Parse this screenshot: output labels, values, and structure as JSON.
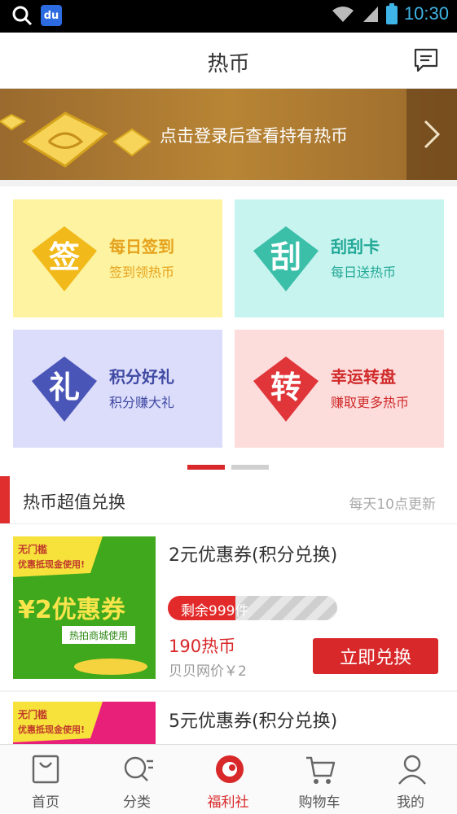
{
  "status_bar": {
    "time": "10:30",
    "baidu_icon_text": "du"
  },
  "header": {
    "title": "热币"
  },
  "banner": {
    "text": "点击登录后查看持有热币"
  },
  "grid": [
    {
      "badge": "签",
      "title": "每日签到",
      "subtitle": "签到领热币",
      "bg": "#fdf3a0",
      "accent": "#e6a21c",
      "badge_color": "#f2b91a"
    },
    {
      "badge": "刮",
      "title": "刮刮卡",
      "subtitle": "每日送热币",
      "bg": "#c8f4ef",
      "accent": "#22a896",
      "badge_color": "#3cbfa9"
    },
    {
      "badge": "礼",
      "title": "积分好礼",
      "subtitle": "积分赚大礼",
      "bg": "#dcdcfb",
      "accent": "#3f4aa3",
      "badge_color": "#4a55b8"
    },
    {
      "badge": "转",
      "title": "幸运转盘",
      "subtitle": "赚取更多热币",
      "bg": "#fddcdc",
      "accent": "#d02a2a",
      "badge_color": "#e0363a"
    }
  ],
  "pager": {
    "active_index": 0,
    "count": 2
  },
  "section": {
    "title": "热币超值兑换",
    "note": "每天10点更新"
  },
  "items": [
    {
      "name": "2元优惠券(积分兑换)",
      "thumb": {
        "tag": "无门槛",
        "tag2": "优惠抵现金使用!",
        "big": "¥2优惠券",
        "sub": "热拍商城使用"
      },
      "remaining": "剩余999件",
      "remaining_fraction": 0.4,
      "price": "190热币",
      "ref_price": "贝贝网价￥2",
      "button": "立即兑换"
    },
    {
      "name": "5元优惠券(积分兑换)",
      "thumb": {
        "tag": "无门槛",
        "tag2": "优惠抵现金使用!"
      }
    }
  ],
  "tabs": [
    {
      "label": "首页",
      "icon": "bag-icon",
      "active": false
    },
    {
      "label": "分类",
      "icon": "category-search-icon",
      "active": false
    },
    {
      "label": "福利社",
      "icon": "welfare-icon",
      "active": true
    },
    {
      "label": "购物车",
      "icon": "cart-icon",
      "active": false
    },
    {
      "label": "我的",
      "icon": "user-icon",
      "active": false
    }
  ],
  "colors": {
    "brand_red": "#d8282a",
    "banner_gold": "#b88535"
  }
}
